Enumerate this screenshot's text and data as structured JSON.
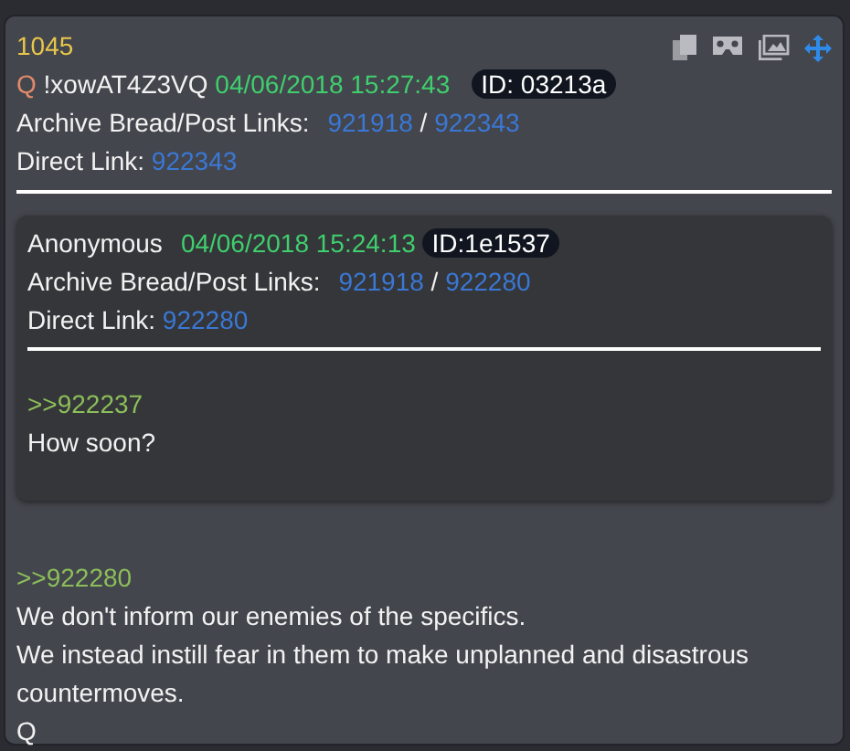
{
  "post": {
    "number": "1045",
    "name": "Q",
    "tripcode": "!xowAT4Z3VQ",
    "date": "04/06/2018 15:27:43",
    "id": "ID: 03213a",
    "archive_label": "Archive Bread/Post Links:",
    "archive_links": [
      "921918",
      "922343"
    ],
    "separator": "/",
    "direct_label": "Direct Link:",
    "direct_link": "922343"
  },
  "quoted": {
    "name": "Anonymous",
    "date": "04/06/2018 15:24:13",
    "id": "ID:1e1537",
    "archive_label": "Archive Bread/Post Links:",
    "archive_links": [
      "921918",
      "922280"
    ],
    "separator": "/",
    "direct_label": "Direct Link:",
    "direct_link": "922280",
    "reply_to": ">>922237",
    "lines": [
      "How soon?"
    ]
  },
  "reply": {
    "reply_to": ">>922280",
    "lines": [
      "We don't inform our enemies of the specifics.",
      "We instead instill fear in them to make unplanned and disastrous countermoves.",
      "Q"
    ]
  }
}
